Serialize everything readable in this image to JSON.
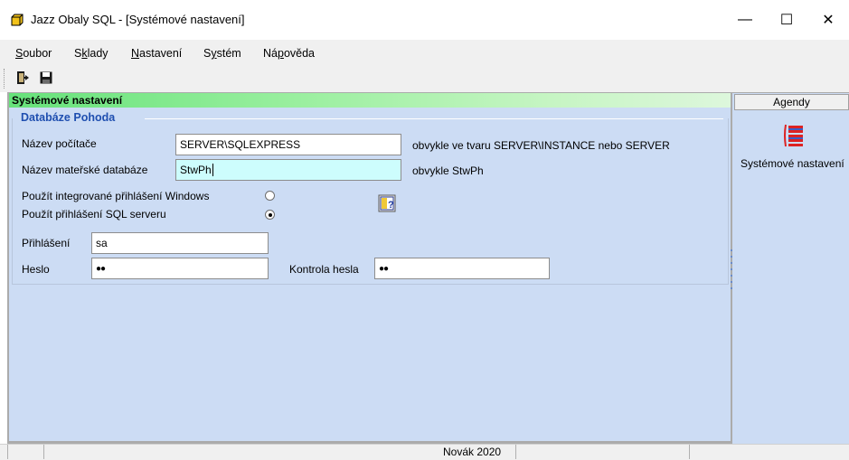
{
  "window": {
    "title": "Jazz Obaly SQL - [Systémové nastavení]",
    "minimize_glyph": "—",
    "maximize_glyph": "☐",
    "close_glyph": "✕"
  },
  "menu": [
    {
      "label": "Soubor",
      "accel": "S",
      "rest": "oubor"
    },
    {
      "label": "Sklady",
      "accel": "S",
      "rest": "klady",
      "pre": ""
    },
    {
      "label": "Nastavení",
      "accel": "N",
      "rest": "astavení"
    },
    {
      "label": "Systém",
      "accel": "y",
      "pre": "S",
      "rest": "stém"
    },
    {
      "label": "Nápověda",
      "accel": "p",
      "pre": "Ná",
      "rest": "ověda"
    }
  ],
  "menu_text": {
    "soubor_pre": "",
    "soubor_accel": "S",
    "soubor_rest": "oubor",
    "sklady_pre": "S",
    "sklady_accel": "k",
    "sklady_rest": "lady",
    "nastaveni_pre": "",
    "nastaveni_accel": "N",
    "nastaveni_rest": "astavení",
    "system_pre": "S",
    "system_accel": "y",
    "system_rest": "stém",
    "napoveda_pre": "Ná",
    "napoveda_accel": "p",
    "napoveda_rest": "ověda"
  },
  "toolbar": {
    "exit_icon": "exit-door-icon",
    "save_icon": "floppy-disk-icon"
  },
  "main": {
    "header": "Systémové nastavení",
    "section_title": "Databáze Pohoda",
    "computer_name_label": "Název počítače",
    "computer_name_value": "SERVER\\SQLEXPRESS",
    "computer_name_hint": "obvykle ve tvaru SERVER\\INSTANCE nebo SERVER",
    "db_name_label": "Název mateřské databáze",
    "db_name_value": "StwPh",
    "db_name_hint": "obvykle StwPh",
    "windows_login_label": "Použít integrované přihlášení Windows",
    "sql_login_label": "Použít přihlášení SQL serveru",
    "windows_login_selected": false,
    "sql_login_selected": true,
    "help_icon": "help-book-icon",
    "login_label": "Přihlášení",
    "login_value": "sa",
    "password_label": "Heslo",
    "password_value": "●●",
    "password_check_label": "Kontrola hesla",
    "password_check_value": "●●"
  },
  "agendy": {
    "header": "Agendy",
    "items": [
      {
        "label": "Systémové nastavení",
        "icon": "settings-list-icon"
      }
    ]
  },
  "statusbar": {
    "user": "Novák 2020"
  },
  "colors": {
    "panel_bg": "#ccdcf4",
    "header_green": "#66e27a",
    "section_blue": "#1f4fb0",
    "active_field": "#cdfdfd"
  }
}
